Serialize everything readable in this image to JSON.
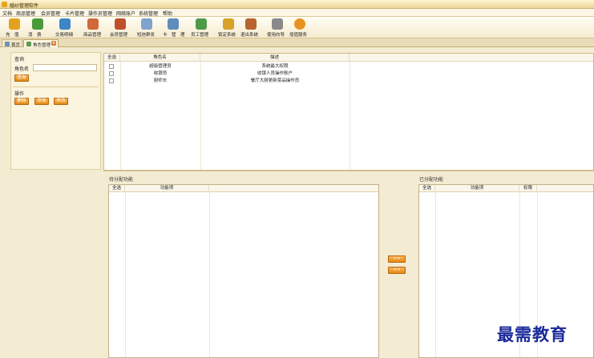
{
  "window": {
    "title": "婚纱管理软件"
  },
  "menu": [
    "文档",
    "商品管理",
    "会员管理",
    "卡片管理",
    "操作员管理",
    "网络账户",
    "系统管理",
    "帮助"
  ],
  "toolbar": [
    {
      "label": "充　值",
      "icon": "coins-icon",
      "color": "#e3a21d"
    },
    {
      "label": "消　费",
      "icon": "cart-icon",
      "color": "#4a9b3a"
    },
    {
      "label": "交易明细",
      "icon": "calendar-icon",
      "color": "#3d86c6"
    },
    {
      "label": "商品管理",
      "icon": "box-icon",
      "color": "#d2683a"
    },
    {
      "label": "会员管理",
      "icon": "member-icon",
      "color": "#c04f2c"
    },
    {
      "label": "短信群发",
      "icon": "mail-icon",
      "color": "#7fa2cf"
    },
    {
      "label": "卡　管　理",
      "icon": "card-icon",
      "color": "#5e8dbd"
    },
    {
      "label": "员工管理",
      "icon": "staff-icon",
      "color": "#4f9a4a"
    },
    {
      "label": "锁定系统",
      "icon": "lock-icon",
      "color": "#d8a22b"
    },
    {
      "label": "退出系统",
      "icon": "house-icon",
      "color": "#b8642d"
    },
    {
      "label": "使用向导",
      "icon": "guide-icon",
      "color": "#8a8a8a"
    },
    {
      "label": "增值服务",
      "icon": "dollar-icon",
      "color": "#e89320"
    }
  ],
  "tabs": {
    "home": "首页",
    "role": "角色管理",
    "close": "×"
  },
  "query": {
    "group_title": "查询",
    "role_name_label": "角色名",
    "role_name_value": "",
    "search_button": "查询"
  },
  "operations": {
    "group_title": "操作",
    "delete_button": "删除",
    "add_button": "添加",
    "edit_button": "修改"
  },
  "role_table": {
    "headers": [
      "全选",
      "角色名",
      "描述"
    ],
    "rows": [
      {
        "name": "超级管理员",
        "desc": "系统最大权限"
      },
      {
        "name": "收银员",
        "desc": "收银人员操作账户"
      },
      {
        "name": "厨师长",
        "desc": "餐厅大厨更新菜品操作员"
      }
    ]
  },
  "pending_functions": {
    "label": "待分配功能",
    "headers": [
      "全选",
      "功能项"
    ]
  },
  "assigned_functions": {
    "label": "已分配功能",
    "headers": [
      "全选",
      "功能项",
      "权限"
    ]
  },
  "arrows": {
    "assign": ">>",
    "remove": "<<"
  },
  "colors": {
    "accent": "#e58a12",
    "background": "#f4ebd3"
  },
  "watermark": "最需教育"
}
